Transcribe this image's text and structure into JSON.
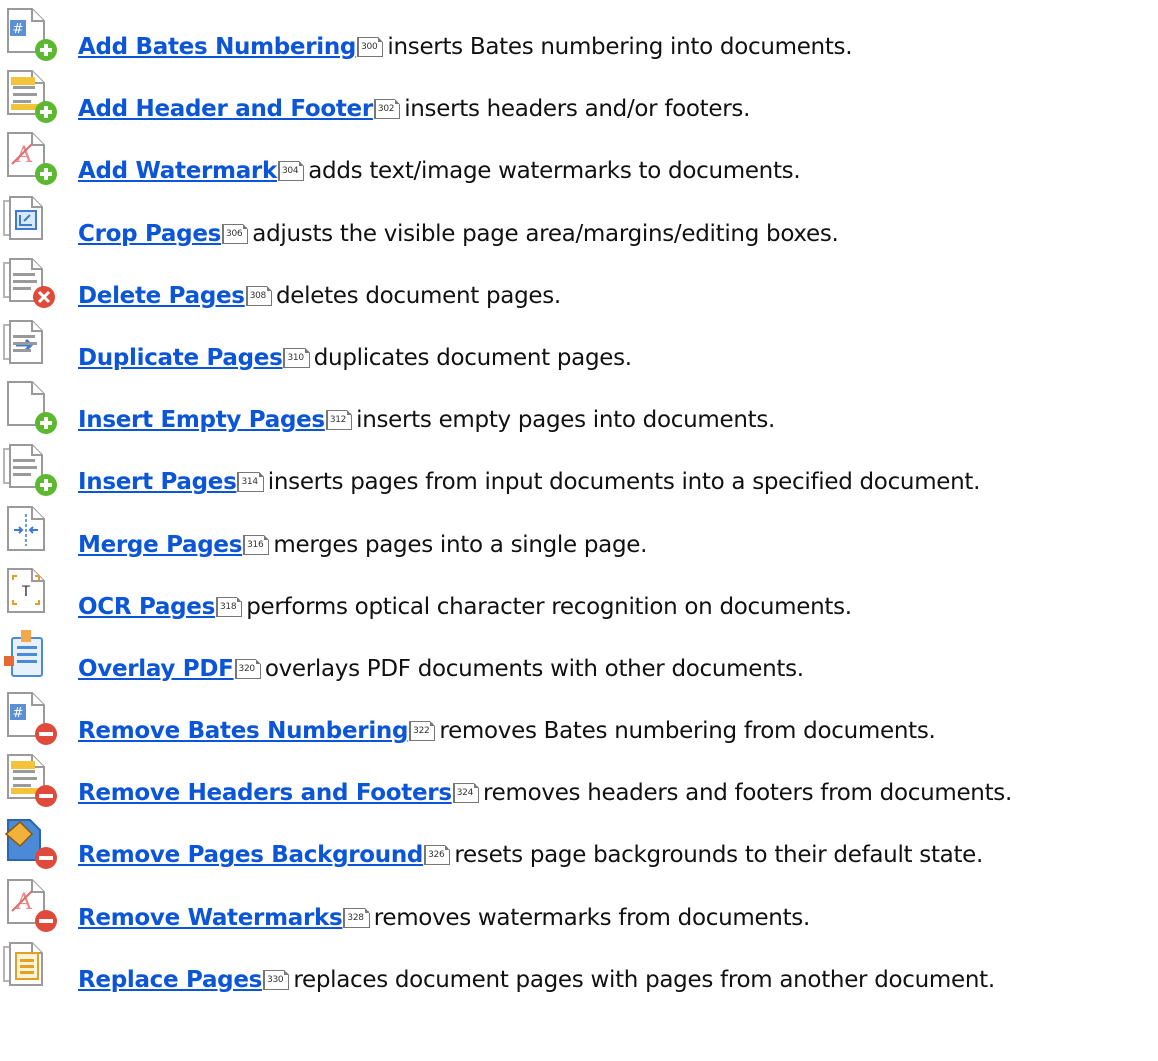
{
  "colors": {
    "link": "#0b55d8",
    "plus": "#5cb82e",
    "minus": "#e04a3b",
    "paper_line": "#9a9a9a"
  },
  "items": [
    {
      "icon": "bates-add-icon",
      "link": "Add Bates Numbering",
      "page": "300",
      "text": "inserts Bates numbering into documents."
    },
    {
      "icon": "header-footer-add-icon",
      "link": "Add Header and Footer",
      "page": "302",
      "text": "inserts headers and/or footers."
    },
    {
      "icon": "watermark-add-icon",
      "link": "Add Watermark",
      "page": "304",
      "text": "adds text/image watermarks to documents."
    },
    {
      "icon": "crop-pages-icon",
      "link": "Crop Pages",
      "page": "306",
      "text": "adjusts the visible page area/margins/editing boxes."
    },
    {
      "icon": "delete-pages-icon",
      "link": "Delete Pages",
      "page": "308",
      "text": "deletes document pages."
    },
    {
      "icon": "duplicate-pages-icon",
      "link": "Duplicate Pages",
      "page": "310",
      "text": "duplicates document pages."
    },
    {
      "icon": "insert-empty-pages-icon",
      "link": "Insert Empty Pages",
      "page": "312",
      "text": "inserts empty pages into documents."
    },
    {
      "icon": "insert-pages-icon",
      "link": "Insert Pages",
      "page": "314",
      "text": "inserts pages from input documents into a specified document."
    },
    {
      "icon": "merge-pages-icon",
      "link": "Merge Pages",
      "page": "316",
      "text": "merges pages into a single page."
    },
    {
      "icon": "ocr-pages-icon",
      "link": "OCR Pages",
      "page": "318",
      "text": "performs optical character recognition on documents."
    },
    {
      "icon": "overlay-pdf-icon",
      "link": "Overlay PDF",
      "page": "320",
      "text": "overlays PDF documents with other documents."
    },
    {
      "icon": "bates-remove-icon",
      "link": "Remove Bates Numbering",
      "page": "322",
      "text": "removes Bates numbering from documents."
    },
    {
      "icon": "header-footer-remove-icon",
      "link": "Remove Headers and Footers",
      "page": "324",
      "text": "removes headers and footers from documents."
    },
    {
      "icon": "background-remove-icon",
      "link": "Remove Pages Background",
      "page": "326",
      "text": "resets page backgrounds to their default state."
    },
    {
      "icon": "watermark-remove-icon",
      "link": "Remove Watermarks",
      "page": "328",
      "text": "removes watermarks from documents."
    },
    {
      "icon": "replace-pages-icon",
      "link": "Replace Pages",
      "page": "330",
      "text": "replaces document pages with pages from another document."
    }
  ]
}
